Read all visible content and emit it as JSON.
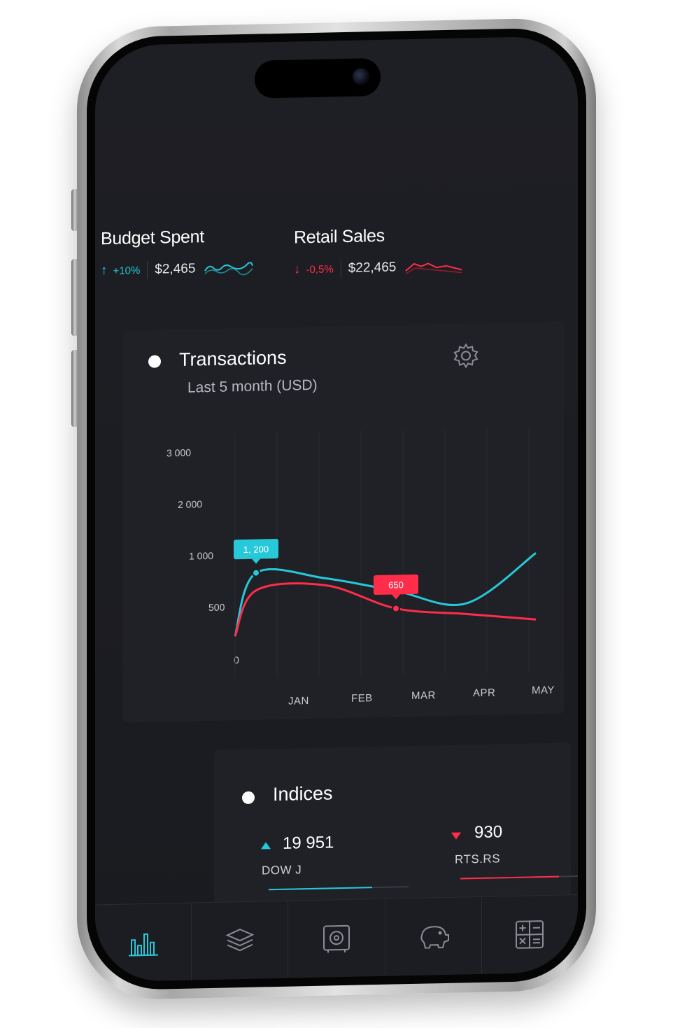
{
  "stats": {
    "budget": {
      "title": "Budget Spent",
      "pct": "+10%",
      "value": "$2,465",
      "color": "#27c8d8"
    },
    "retail": {
      "title": "Retail Sales",
      "pct": "-0,5%",
      "value": "$22,465",
      "color": "#ff2d4a"
    }
  },
  "transactions": {
    "title": "Transactions",
    "subtitle": "Last 5 month (USD)",
    "icon": "gear-icon"
  },
  "chart_data": {
    "type": "line",
    "categories": [
      "JAN",
      "FEB",
      "MAR",
      "APR",
      "MAY"
    ],
    "y_ticks": [
      "3 000",
      "2 000",
      "1 000",
      "500",
      "0"
    ],
    "series": [
      {
        "color": "#27c8d8",
        "values": [
          1200,
          1100,
          900,
          700,
          1400
        ]
      },
      {
        "color": "#ff2d4a",
        "values": [
          950,
          1000,
          650,
          550,
          450
        ]
      }
    ],
    "callouts": [
      {
        "label": "1, 200",
        "color": "#27c8d8"
      },
      {
        "label": "650",
        "color": "#ff2d4a"
      }
    ]
  },
  "indices": {
    "title": "Indices",
    "items": [
      {
        "value": "19 951",
        "name": "DOW J",
        "trend": "up",
        "color": "#27c8d8",
        "level": 0.74
      },
      {
        "value": "930",
        "name": "RTS.RS",
        "trend": "down",
        "color": "#ff2d4a",
        "level": 0.72
      }
    ]
  },
  "tabs": [
    {
      "icon": "bar-chart-icon",
      "active": true
    },
    {
      "icon": "layers-icon",
      "active": false
    },
    {
      "icon": "safe-icon",
      "active": false
    },
    {
      "icon": "piggy-bank-icon",
      "active": false
    },
    {
      "icon": "calculator-icon",
      "active": false
    }
  ]
}
